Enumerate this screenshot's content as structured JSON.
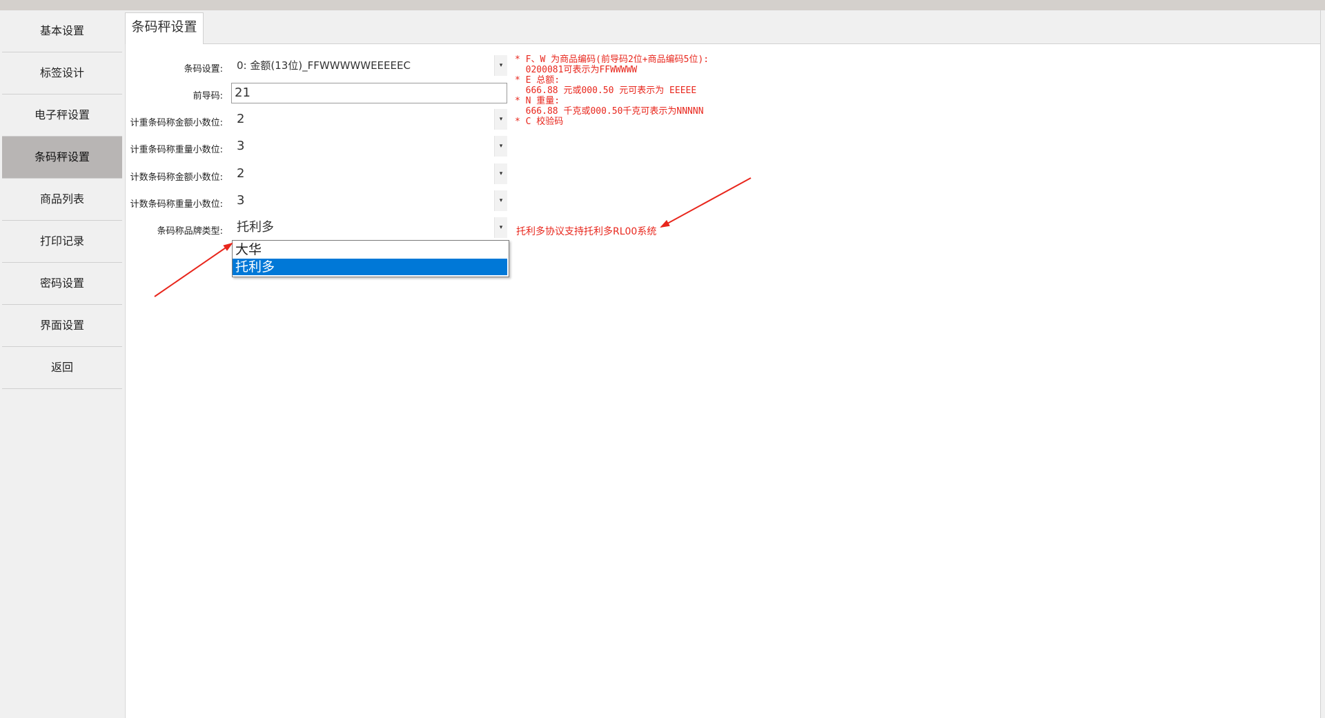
{
  "sidebar": {
    "items": [
      {
        "label": "基本设置"
      },
      {
        "label": "标签设计"
      },
      {
        "label": "电子秤设置"
      },
      {
        "label": "条码秤设置",
        "active": true
      },
      {
        "label": "商品列表"
      },
      {
        "label": "打印记录"
      },
      {
        "label": "密码设置"
      },
      {
        "label": "界面设置"
      },
      {
        "label": "返回"
      }
    ]
  },
  "tab": {
    "title": "条码秤设置"
  },
  "form": {
    "barcode_setting": {
      "label": "条码设置:",
      "value": "0: 金额(13位)_FFWWWWWEEEEEC"
    },
    "prefix": {
      "label": "前导码:",
      "value": "21"
    },
    "weighing_amount_decimals": {
      "label": "计重条码称金额小数位:",
      "value": "2"
    },
    "weighing_weight_decimals": {
      "label": "计重条码称重量小数位:",
      "value": "3"
    },
    "counting_amount_decimals": {
      "label": "计数条码称金额小数位:",
      "value": "2"
    },
    "counting_weight_decimals": {
      "label": "计数条码称重量小数位:",
      "value": "3"
    },
    "brand_type": {
      "label": "条码称品牌类型:",
      "value": "托利多",
      "options": [
        "大华",
        "托利多"
      ],
      "selected_index": 1
    }
  },
  "notes": {
    "lines": [
      "* F、W 为商品编码(前导码2位+商品编码5位):",
      "  0200081可表示为FFWWWWW",
      "* E 总额:",
      "  666.88 元或000.50 元可表示为 EEEEE",
      "* N 重量:",
      "  666.88 千克或000.50千克可表示为NNNNN",
      "* C 校验码"
    ]
  },
  "annotation": {
    "text": "托利多协议支持托利多RL00系统"
  },
  "colors": {
    "accent": "#e8261c",
    "selection": "#0078d7",
    "sidebar_active": "#b8b5b4",
    "sidebar_bg": "#f0f0f0"
  }
}
